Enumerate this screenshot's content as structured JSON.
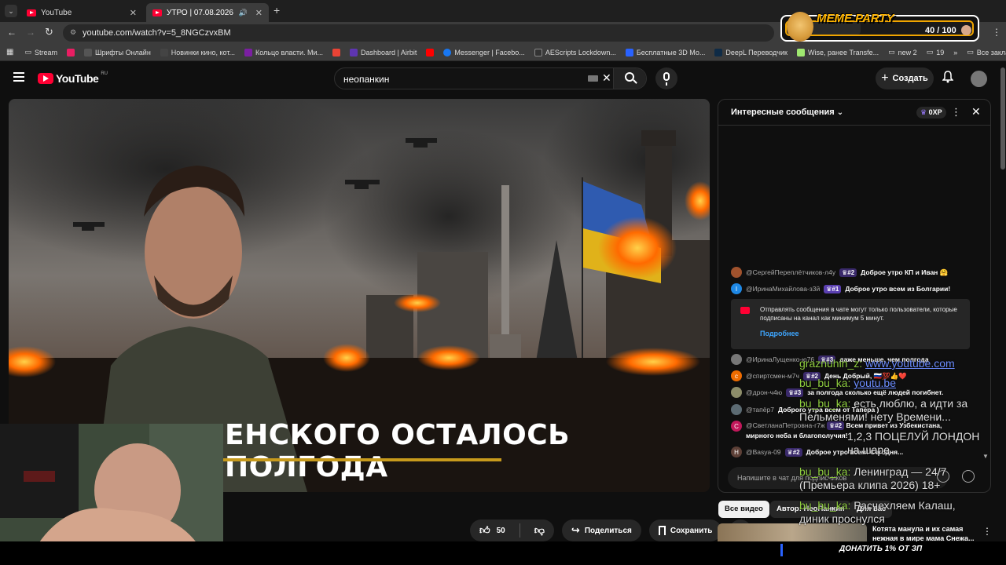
{
  "browser": {
    "tabs": [
      {
        "label": "YouTube"
      },
      {
        "label": "УТРО | 07.08.2026 - YouTub"
      }
    ],
    "new_tab": "+",
    "url": "youtube.com/watch?v=5_8NGCzvxBM",
    "bookmarks": [
      {
        "label": "Stream",
        "color": "#888888"
      },
      {
        "label": "",
        "color": "#e91e63"
      },
      {
        "label": "Шрифты Онлайн",
        "color": "#555555"
      },
      {
        "label": "Новинки кино, кот...",
        "color": "#444444"
      },
      {
        "label": "Кольцо власти. Ми...",
        "color": "#7b1fa2"
      },
      {
        "label": "",
        "color": "#ea4335"
      },
      {
        "label": "Dashboard | Airbit",
        "color": "#5e35b1"
      },
      {
        "label": "",
        "color": "#ff0000"
      },
      {
        "label": "Messenger | Facebo...",
        "color": "#1877f2"
      },
      {
        "label": "AEScripts Lockdown...",
        "color": "#333333"
      },
      {
        "label": "Бесплатные 3D Мо...",
        "color": "#2962ff"
      },
      {
        "label": "DeepL Переводчик",
        "color": "#0f2b46"
      },
      {
        "label": "Wise, ранее Transfe...",
        "color": "#9fe870"
      },
      {
        "label": "new 2",
        "color": ""
      },
      {
        "label": "19",
        "color": ""
      }
    ],
    "all_bookmarks": "Все закладки",
    "more_bookmarks": "»"
  },
  "meme_widget": {
    "title": "MEME PARTY",
    "progress_text": "40 / 100",
    "progress_fraction": 0.4
  },
  "youtube": {
    "logo_text": "YouTube",
    "region": "RU",
    "search_query": "неопанкин",
    "create_label": "Создать"
  },
  "video": {
    "caption": "ЕНСКОГО ОСТАЛОСЬ ПОЛГОДА",
    "like_count": "50",
    "share_label": "Поделиться",
    "save_label": "Сохранить",
    "more": "•••"
  },
  "chat": {
    "header": "Интересные сообщения",
    "xp_badge": "0XP",
    "messages": [
      {
        "user": "@СергейПереплётчиков-л4у",
        "badge": "#2",
        "text": "Доброе утро КП и Иван 🤗",
        "avatar_color": "#a0522d",
        "avatar_letter": ""
      },
      {
        "user": "@ИринаМихайлова-з3й",
        "badge": "#1",
        "text": "Доброе утро всем из Болгарии!",
        "avatar_color": "#1e88e5",
        "avatar_letter": "I"
      },
      {
        "user": "@ИринаЛущенко-ю76",
        "badge": "#3",
        "text": "даже меньше, чем полгода",
        "avatar_color": "#777777",
        "avatar_letter": ""
      },
      {
        "user": "@спиртсмен-м7ч",
        "badge": "#2",
        "text": "День Добрый, 🇷🇺💯👍❤️",
        "avatar_color": "#ef6c00",
        "avatar_letter": "c"
      },
      {
        "user": "@дрон-ч4ю",
        "badge": "#3",
        "text": "за полгода сколько ещё людей погибнет.",
        "avatar_color": "#8d8d6a",
        "avatar_letter": ""
      },
      {
        "user": "@тапёр7",
        "badge": "",
        "text": "Доброго утра всем от Тапёра )",
        "avatar_color": "#5c6b73",
        "avatar_letter": ""
      },
      {
        "user": "@СветланаПетровна-г7ж",
        "badge": "#2",
        "text": "Всем привет из Узбекистана, мирного неба и благополучия!",
        "avatar_color": "#c2185b",
        "avatar_letter": "C"
      },
      {
        "user": "@Basya-09",
        "badge": "#2",
        "text": "Доброе утро всем! Сегодня...",
        "avatar_color": "#5d4037",
        "avatar_letter": "H"
      }
    ],
    "notice_text": "Отправлять сообщения в чате могут только пользователи, которые подписаны на канал как минимум 5 минут.",
    "notice_link": "Подробнее",
    "input_placeholder": "Напишите в чат для подписчиков"
  },
  "filters": {
    "chips": [
      "Все видео",
      "Автор: НеоПанкин",
      "Для вас"
    ]
  },
  "recommendation": {
    "title": "Котята манула и их самая нежная в мире мама Снежа..."
  },
  "overlay_chat": [
    {
      "user": "graznuhin_z:",
      "text": "www.youtube.com",
      "link": true
    },
    {
      "user": "bu_bu_ka:",
      "text": "youtu.be",
      "link": true
    },
    {
      "user": "bu_bu_ka:",
      "text": "есть люблю, а идти за Пельменями! нету Времени...",
      "link": false
    },
    {
      "user": "",
      "text": "1,2,3 ПОЦЕЛУЙ ЛОНДОН на шаре",
      "link": false
    },
    {
      "user": "bu_bu_ka:",
      "text": "Ленинград — 24/7 (Премьера клипа 2026) 18+",
      "link": false
    },
    {
      "user": "bu_bu_ka:",
      "text": "Расчехляем Калаш, диник проснулся",
      "link": false
    }
  ],
  "donate_text": "ДОНАТИТЬ 1% ОТ ЗП"
}
